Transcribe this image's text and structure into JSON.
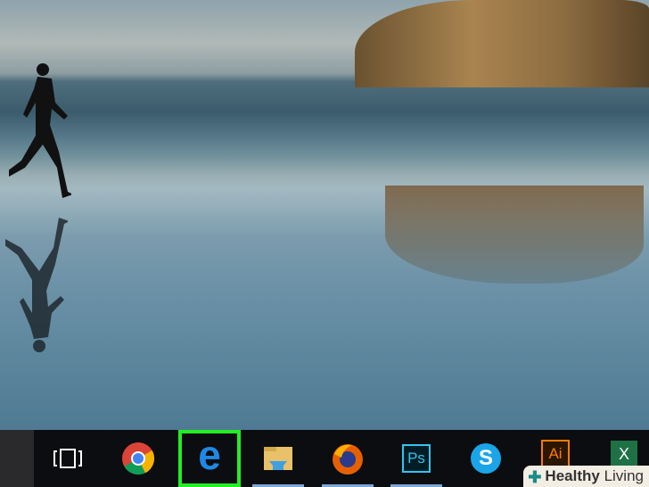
{
  "taskbar": {
    "items": [
      {
        "name": "task-view",
        "icon": "task-view-icon",
        "running": false,
        "selected": false
      },
      {
        "name": "chrome",
        "icon": "chrome-icon",
        "running": false,
        "selected": false
      },
      {
        "name": "edge",
        "icon": "edge-icon",
        "running": false,
        "selected": true
      },
      {
        "name": "file-explorer",
        "icon": "folder-icon",
        "running": true,
        "selected": false
      },
      {
        "name": "firefox",
        "icon": "firefox-icon",
        "running": true,
        "selected": false
      },
      {
        "name": "photoshop",
        "icon": "photoshop-icon",
        "label": "Ps",
        "running": true,
        "selected": false
      },
      {
        "name": "skype",
        "icon": "skype-icon",
        "label": "S",
        "running": false,
        "selected": false
      },
      {
        "name": "illustrator",
        "icon": "illustrator-icon",
        "label": "Ai",
        "running": false,
        "selected": false
      },
      {
        "name": "excel",
        "icon": "excel-icon",
        "label": "X",
        "running": false,
        "selected": false
      }
    ],
    "highlight_color": "#22ee22"
  },
  "watermark": {
    "bold": "Healthy",
    "light": "Living"
  },
  "edge_label": "e"
}
